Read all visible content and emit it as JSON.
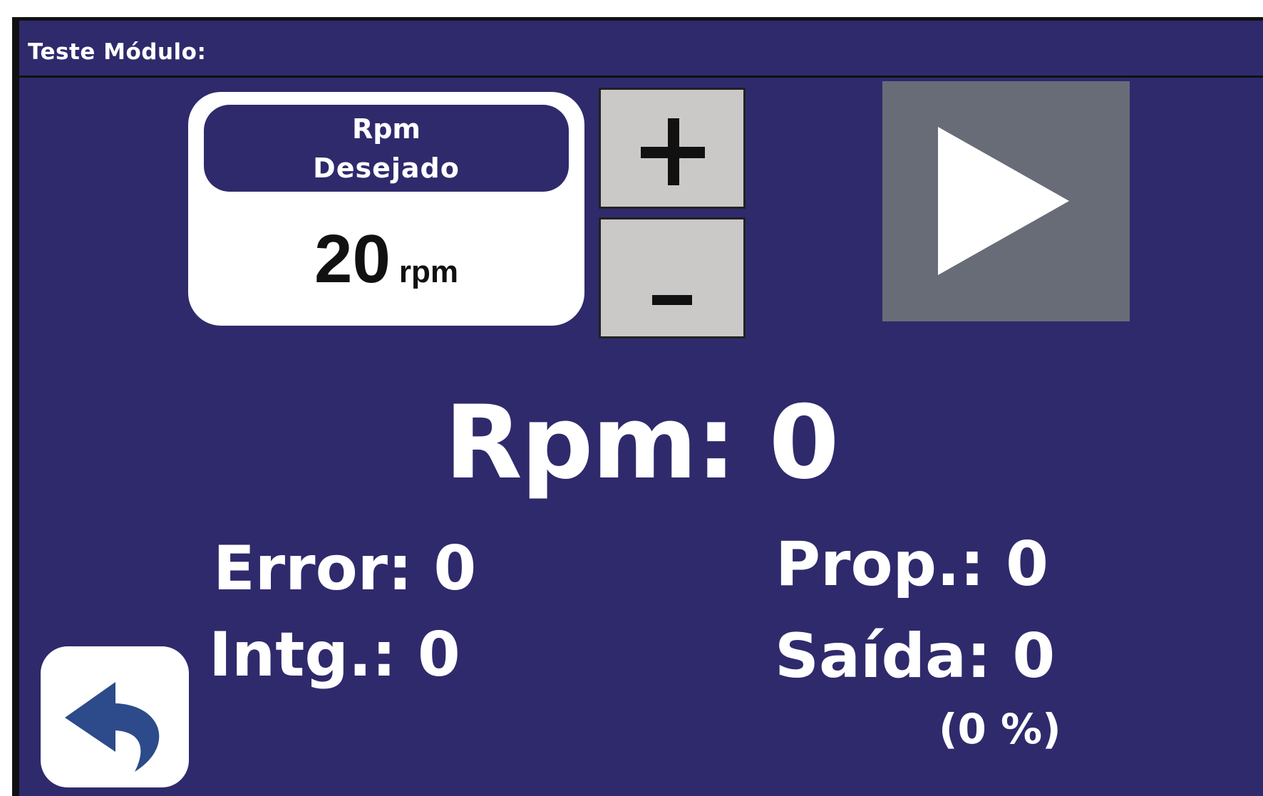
{
  "header": {
    "title": "Teste Módulo:"
  },
  "setpoint": {
    "label_line1": "Rpm",
    "label_line2": "Desejado",
    "value": "20",
    "unit": "rpm"
  },
  "controls": {
    "increment_label": "+",
    "decrement_label": "-",
    "play_icon": "play-icon",
    "back_icon": "undo-arrow-icon"
  },
  "readout": {
    "rpm": "Rpm: 0",
    "error": "Error: 0",
    "integral": "Intg.: 0",
    "proportional": "Prop.: 0",
    "output": "Saída: 0",
    "output_percent": "(0 %)"
  },
  "colors": {
    "background": "#2f2a6c",
    "card": "#ffffff",
    "step_button": "#cbc8c8",
    "play_button": "#686c77",
    "back_arrow": "#2d4a8a"
  }
}
